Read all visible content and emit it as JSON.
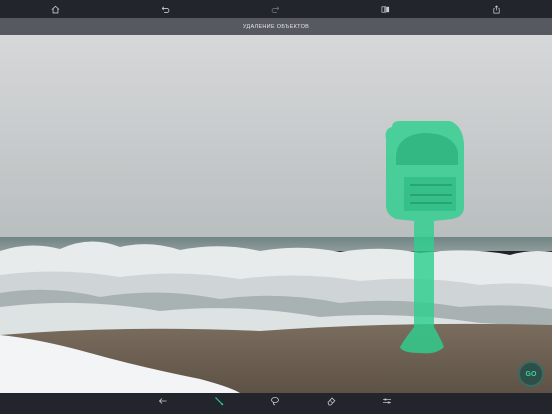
{
  "toolbar": {
    "home_icon": "home-icon",
    "undo_icon": "undo-icon",
    "redo_icon": "redo-icon",
    "compare_icon": "compare-icon",
    "share_icon": "share-icon"
  },
  "title": "УДАЛЕНИЕ ОБЪЕКТОВ",
  "bottom_tools": [
    {
      "icon": "back-arrow-icon",
      "label": ""
    },
    {
      "icon": "brush-icon",
      "label": "",
      "active": true
    },
    {
      "icon": "lasso-icon",
      "label": ""
    },
    {
      "icon": "eraser-icon",
      "label": ""
    },
    {
      "icon": "sliders-icon",
      "label": ""
    }
  ],
  "go_button": "GO",
  "colors": {
    "accent": "#2fc58f",
    "selection_mask": "#2ecf8f",
    "toolbar_bg": "#22262c",
    "title_bg": "#56595f"
  }
}
